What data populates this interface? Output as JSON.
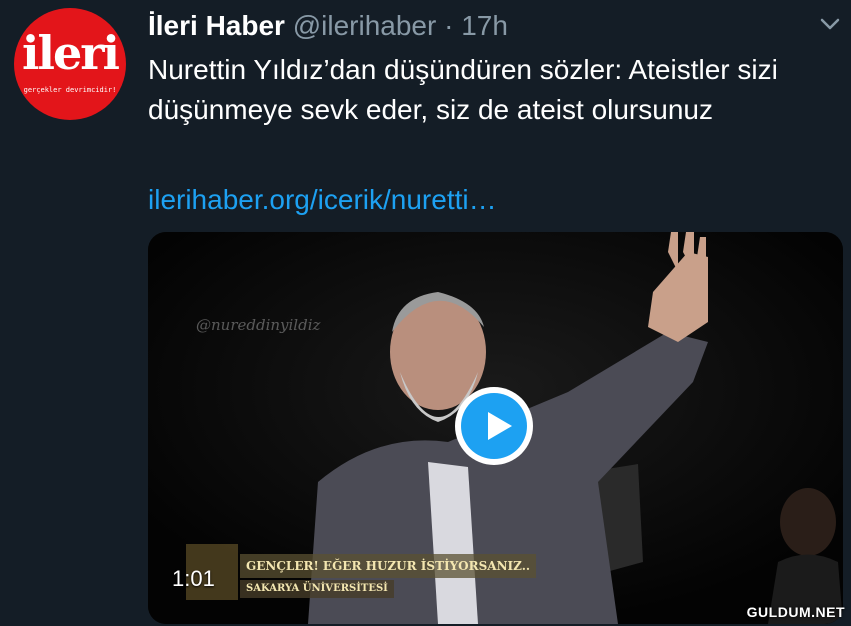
{
  "tweet": {
    "avatar_logo": "ileri",
    "avatar_slogan": "gerçekler devrimcidir!",
    "name": "İleri Haber",
    "handle": "@ilerihaber",
    "separator": "·",
    "time": "17h",
    "text": "Nurettin Yıldız’dan düşündüren sözler: Ateistler sizi düşünmeye sevk eder, siz de ateist olursunuz",
    "link": "ilerihaber.org/icerik/nuretti…"
  },
  "video": {
    "watermark": "@nureddinyildiz",
    "caption_line1": "GENÇLER! EĞER HUZUR İSTİYORSANIZ..",
    "caption_line2": "SAKARYA ÜNİVERSİTESİ",
    "duration": "1:01"
  },
  "site_watermark": "GULDUM.NET",
  "colors": {
    "background": "#141d26",
    "link": "#1da1f2",
    "play_button": "#1da1f2",
    "avatar": "#e3151a"
  }
}
